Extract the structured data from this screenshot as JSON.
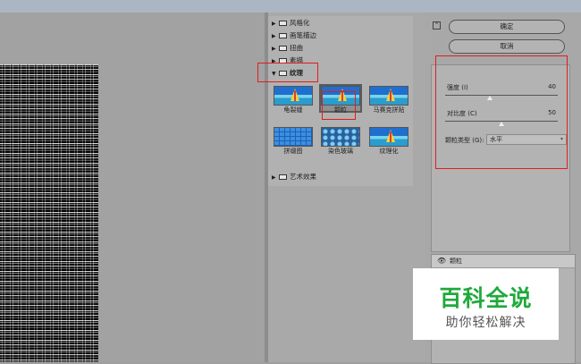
{
  "gallery": {
    "categories": [
      {
        "label": "风格化",
        "expanded": false
      },
      {
        "label": "画笔描边",
        "expanded": false
      },
      {
        "label": "扭曲",
        "expanded": false
      },
      {
        "label": "素描",
        "expanded": false
      },
      {
        "label": "纹理",
        "expanded": true
      },
      {
        "label": "艺术效果",
        "expanded": false
      }
    ],
    "thumbnails": [
      {
        "label": "龟裂缝"
      },
      {
        "label": "颗粒",
        "selected": true
      },
      {
        "label": "马赛克拼贴"
      },
      {
        "label": "拼缀图"
      },
      {
        "label": "染色玻璃"
      },
      {
        "label": "纹理化"
      }
    ]
  },
  "settings": {
    "collapse_icon": "⌃",
    "ok_label": "确定",
    "cancel_label": "取消",
    "filter_select": "颗粒",
    "intensity_label": "强度 (I)",
    "intensity_value": "40",
    "intensity_level": 0.4,
    "contrast_label": "对比度 (C)",
    "contrast_value": "50",
    "contrast_level": 0.5,
    "grain_type_label": "颗粒类型 (G):",
    "grain_type_value": "水平"
  },
  "layers": {
    "items": [
      {
        "label": "颗粒",
        "visible": true
      }
    ]
  },
  "watermark": {
    "title": "百科全说",
    "subtitle": "助你轻松解决"
  },
  "colors": {
    "highlight": "#e21d1d",
    "watermark_green": "#1fa93b"
  }
}
